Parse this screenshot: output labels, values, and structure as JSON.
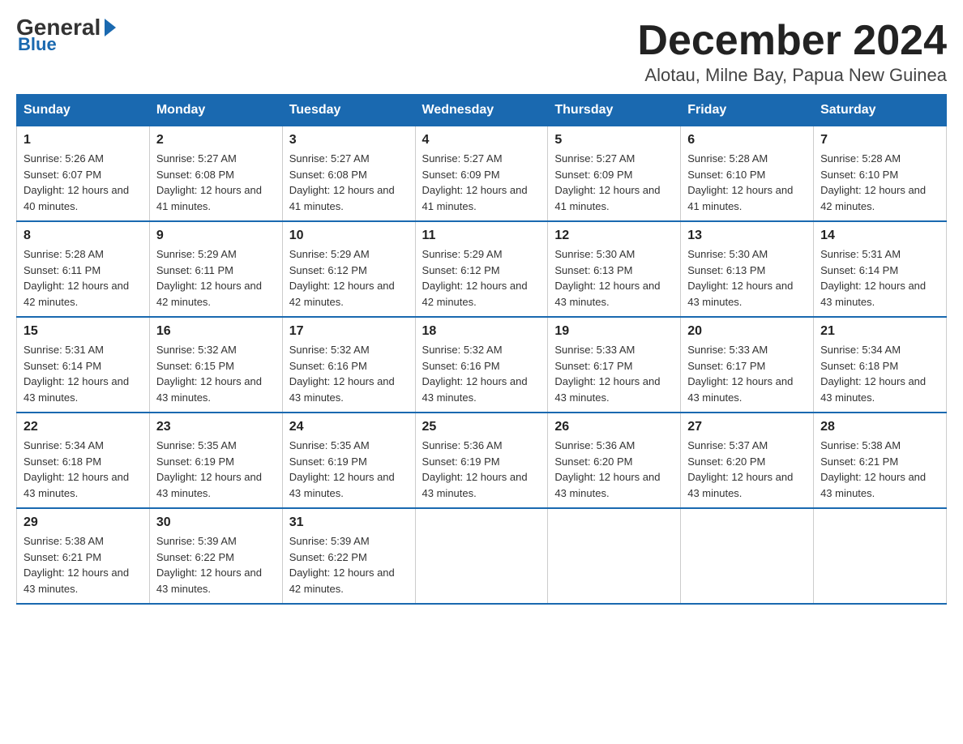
{
  "logo": {
    "general": "General",
    "arrow": "▶",
    "blue": "Blue"
  },
  "title": "December 2024",
  "subtitle": "Alotau, Milne Bay, Papua New Guinea",
  "headers": [
    "Sunday",
    "Monday",
    "Tuesday",
    "Wednesday",
    "Thursday",
    "Friday",
    "Saturday"
  ],
  "weeks": [
    [
      {
        "day": "1",
        "sunrise": "5:26 AM",
        "sunset": "6:07 PM",
        "daylight": "12 hours and 40 minutes."
      },
      {
        "day": "2",
        "sunrise": "5:27 AM",
        "sunset": "6:08 PM",
        "daylight": "12 hours and 41 minutes."
      },
      {
        "day": "3",
        "sunrise": "5:27 AM",
        "sunset": "6:08 PM",
        "daylight": "12 hours and 41 minutes."
      },
      {
        "day": "4",
        "sunrise": "5:27 AM",
        "sunset": "6:09 PM",
        "daylight": "12 hours and 41 minutes."
      },
      {
        "day": "5",
        "sunrise": "5:27 AM",
        "sunset": "6:09 PM",
        "daylight": "12 hours and 41 minutes."
      },
      {
        "day": "6",
        "sunrise": "5:28 AM",
        "sunset": "6:10 PM",
        "daylight": "12 hours and 41 minutes."
      },
      {
        "day": "7",
        "sunrise": "5:28 AM",
        "sunset": "6:10 PM",
        "daylight": "12 hours and 42 minutes."
      }
    ],
    [
      {
        "day": "8",
        "sunrise": "5:28 AM",
        "sunset": "6:11 PM",
        "daylight": "12 hours and 42 minutes."
      },
      {
        "day": "9",
        "sunrise": "5:29 AM",
        "sunset": "6:11 PM",
        "daylight": "12 hours and 42 minutes."
      },
      {
        "day": "10",
        "sunrise": "5:29 AM",
        "sunset": "6:12 PM",
        "daylight": "12 hours and 42 minutes."
      },
      {
        "day": "11",
        "sunrise": "5:29 AM",
        "sunset": "6:12 PM",
        "daylight": "12 hours and 42 minutes."
      },
      {
        "day": "12",
        "sunrise": "5:30 AM",
        "sunset": "6:13 PM",
        "daylight": "12 hours and 43 minutes."
      },
      {
        "day": "13",
        "sunrise": "5:30 AM",
        "sunset": "6:13 PM",
        "daylight": "12 hours and 43 minutes."
      },
      {
        "day": "14",
        "sunrise": "5:31 AM",
        "sunset": "6:14 PM",
        "daylight": "12 hours and 43 minutes."
      }
    ],
    [
      {
        "day": "15",
        "sunrise": "5:31 AM",
        "sunset": "6:14 PM",
        "daylight": "12 hours and 43 minutes."
      },
      {
        "day": "16",
        "sunrise": "5:32 AM",
        "sunset": "6:15 PM",
        "daylight": "12 hours and 43 minutes."
      },
      {
        "day": "17",
        "sunrise": "5:32 AM",
        "sunset": "6:16 PM",
        "daylight": "12 hours and 43 minutes."
      },
      {
        "day": "18",
        "sunrise": "5:32 AM",
        "sunset": "6:16 PM",
        "daylight": "12 hours and 43 minutes."
      },
      {
        "day": "19",
        "sunrise": "5:33 AM",
        "sunset": "6:17 PM",
        "daylight": "12 hours and 43 minutes."
      },
      {
        "day": "20",
        "sunrise": "5:33 AM",
        "sunset": "6:17 PM",
        "daylight": "12 hours and 43 minutes."
      },
      {
        "day": "21",
        "sunrise": "5:34 AM",
        "sunset": "6:18 PM",
        "daylight": "12 hours and 43 minutes."
      }
    ],
    [
      {
        "day": "22",
        "sunrise": "5:34 AM",
        "sunset": "6:18 PM",
        "daylight": "12 hours and 43 minutes."
      },
      {
        "day": "23",
        "sunrise": "5:35 AM",
        "sunset": "6:19 PM",
        "daylight": "12 hours and 43 minutes."
      },
      {
        "day": "24",
        "sunrise": "5:35 AM",
        "sunset": "6:19 PM",
        "daylight": "12 hours and 43 minutes."
      },
      {
        "day": "25",
        "sunrise": "5:36 AM",
        "sunset": "6:19 PM",
        "daylight": "12 hours and 43 minutes."
      },
      {
        "day": "26",
        "sunrise": "5:36 AM",
        "sunset": "6:20 PM",
        "daylight": "12 hours and 43 minutes."
      },
      {
        "day": "27",
        "sunrise": "5:37 AM",
        "sunset": "6:20 PM",
        "daylight": "12 hours and 43 minutes."
      },
      {
        "day": "28",
        "sunrise": "5:38 AM",
        "sunset": "6:21 PM",
        "daylight": "12 hours and 43 minutes."
      }
    ],
    [
      {
        "day": "29",
        "sunrise": "5:38 AM",
        "sunset": "6:21 PM",
        "daylight": "12 hours and 43 minutes."
      },
      {
        "day": "30",
        "sunrise": "5:39 AM",
        "sunset": "6:22 PM",
        "daylight": "12 hours and 43 minutes."
      },
      {
        "day": "31",
        "sunrise": "5:39 AM",
        "sunset": "6:22 PM",
        "daylight": "12 hours and 42 minutes."
      },
      null,
      null,
      null,
      null
    ]
  ]
}
